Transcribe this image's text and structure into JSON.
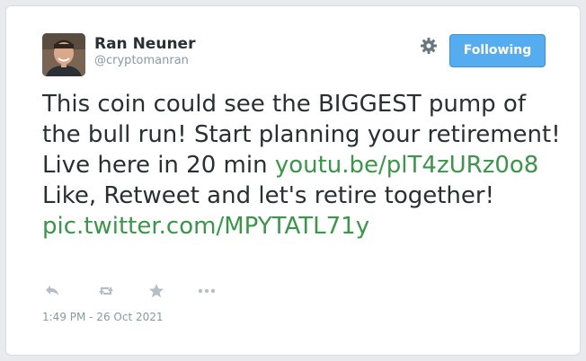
{
  "author": {
    "display_name": "Ran Neuner",
    "handle": "@cryptomanran"
  },
  "follow_button": {
    "label": "Following"
  },
  "tweet": {
    "text_1": "This coin could see the BIGGEST pump of the bull run! Start planning your retirement! Live here in 20 min ",
    "link_1": "youtu.be/plT4zURz0o8",
    "text_2": " Like, Retweet and let's retire together! ",
    "link_2": "pic.twitter.com/MPYTATL71y"
  },
  "actions": {
    "icons": [
      "reply-icon",
      "retweet-icon",
      "favorite-icon",
      "more-icon"
    ]
  },
  "timestamp": "1:49 PM - 26 Oct 2021",
  "colors": {
    "link": "#3a9648",
    "button": "#55acee",
    "muted": "#8899a6",
    "text": "#292f33"
  }
}
